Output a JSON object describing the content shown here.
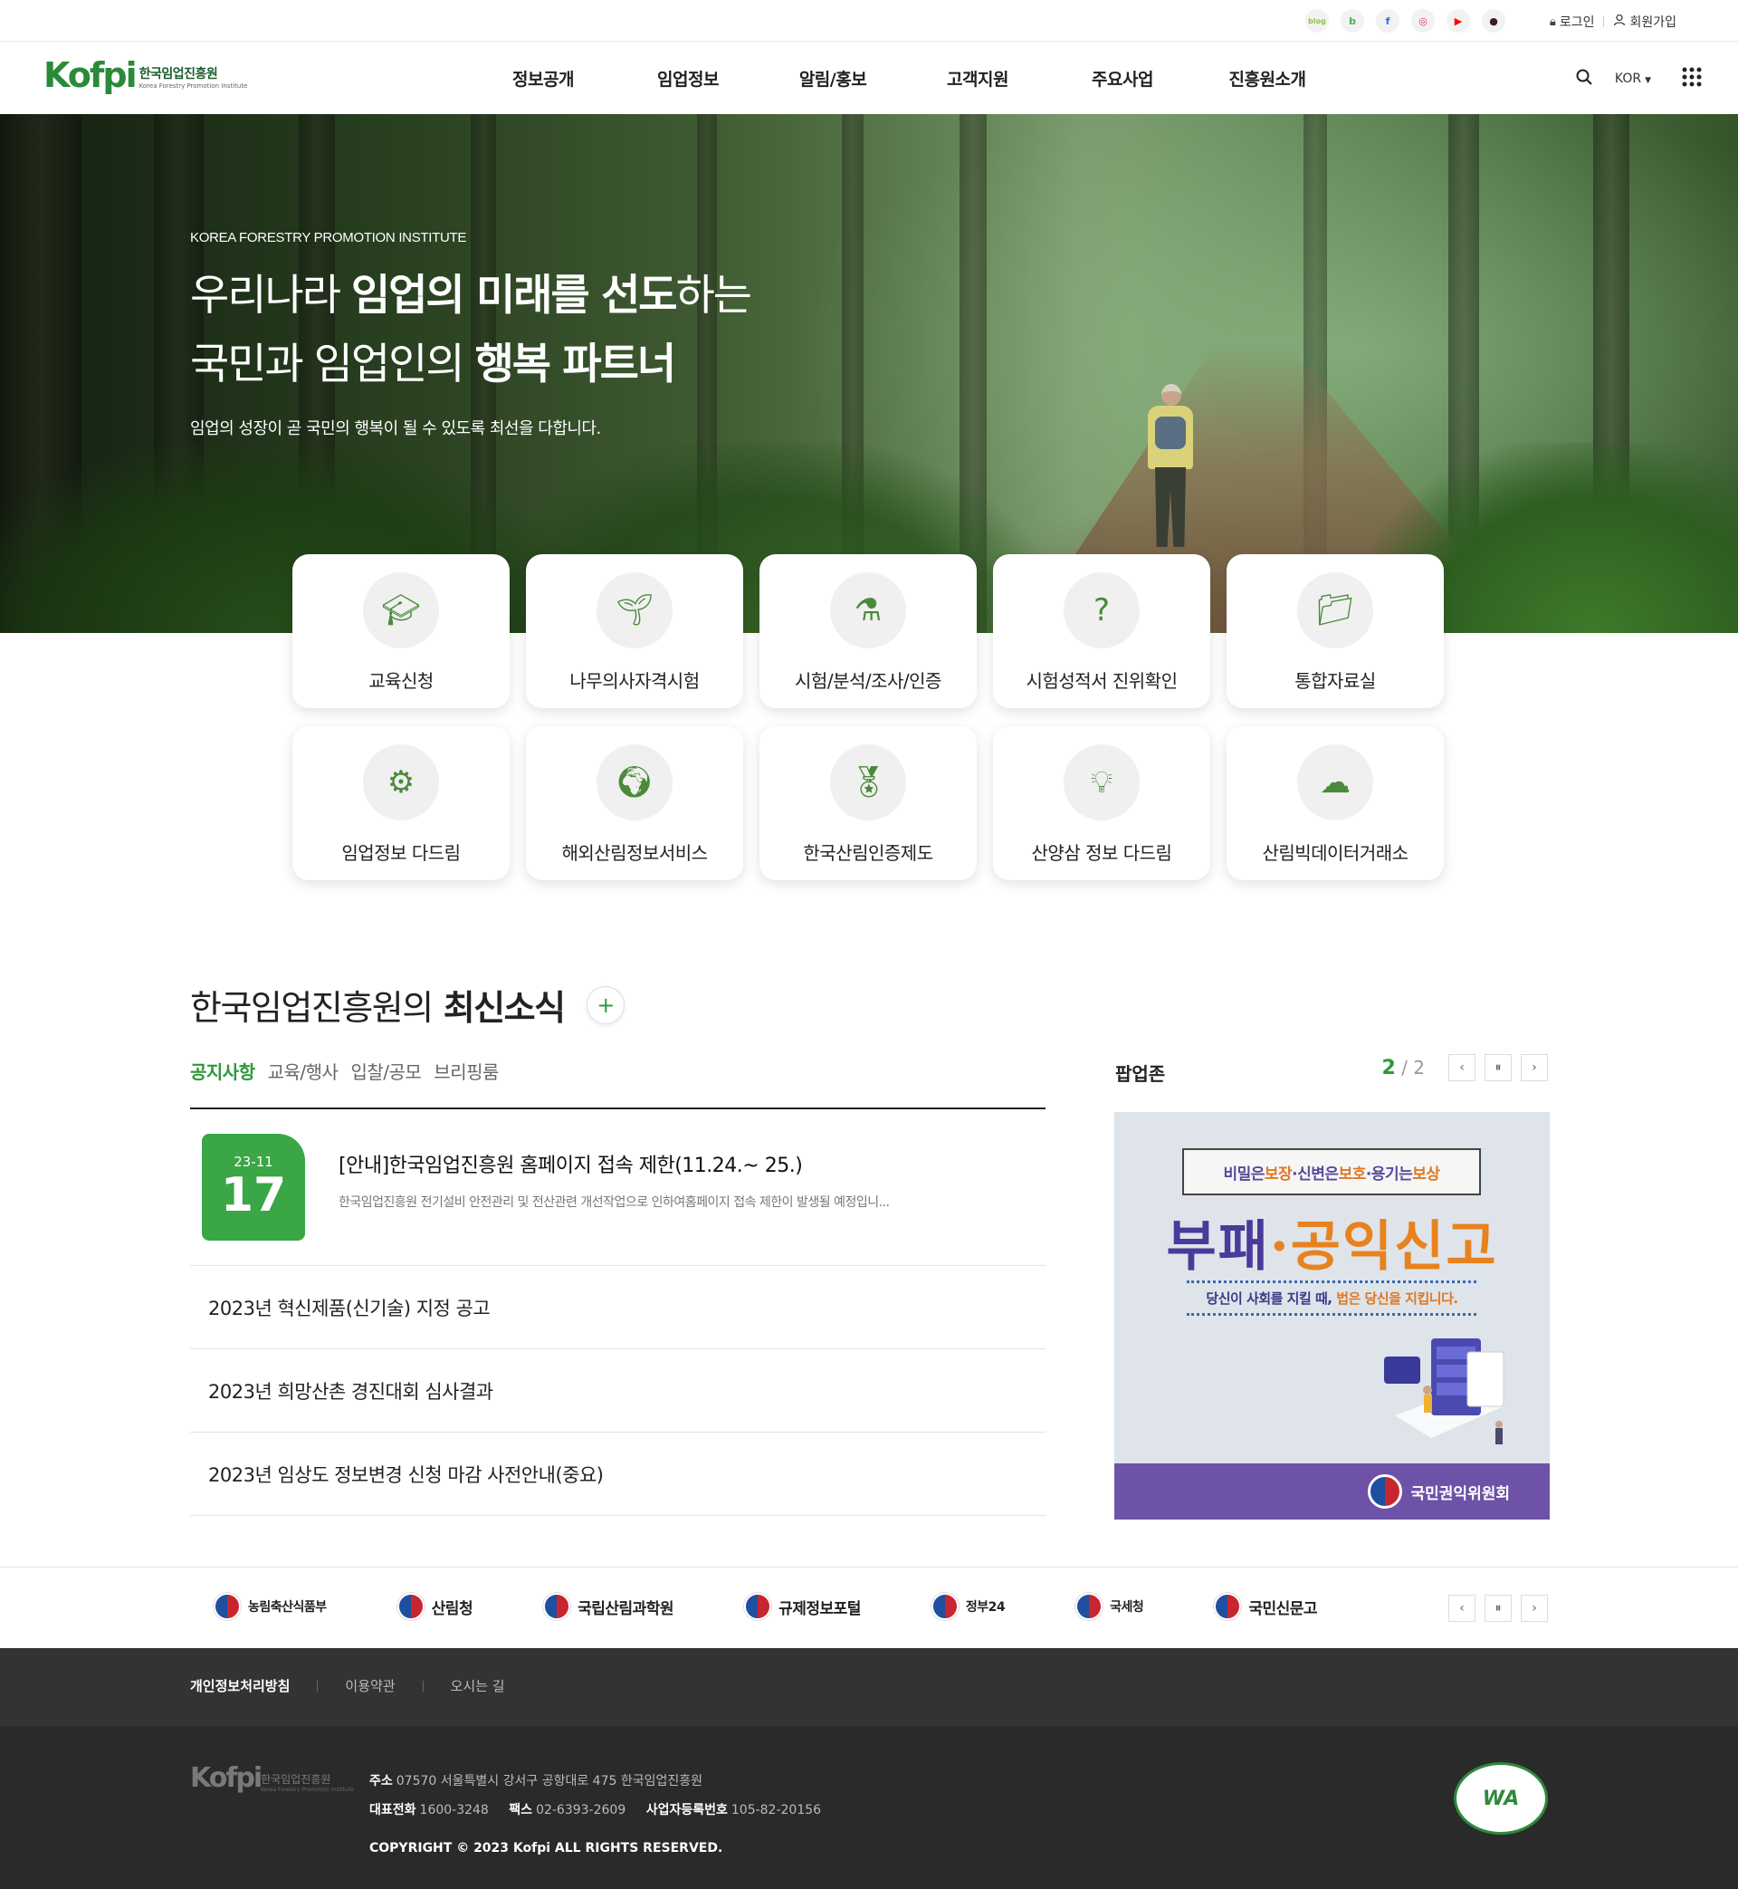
{
  "util": {
    "sns": [
      {
        "icon": "blog-icon",
        "text": "blog",
        "color": "#8bc34a"
      },
      {
        "icon": "band-icon",
        "text": "b",
        "color": "#4caf50"
      },
      {
        "icon": "facebook-icon",
        "text": "f",
        "color": "#1877f2"
      },
      {
        "icon": "instagram-icon",
        "text": "◎",
        "color": "#e1306c"
      },
      {
        "icon": "youtube-icon",
        "text": "▶",
        "color": "#ff0000"
      },
      {
        "icon": "kakao-icon",
        "text": "●",
        "color": "#3c1e1e"
      }
    ],
    "login": "로그인",
    "signup": "회원가입"
  },
  "header": {
    "logo_mark": "Kofpi",
    "logo_ko": "한국임업진흥원",
    "logo_en": "Korea Forestry Promotion Institute",
    "nav": [
      "정보공개",
      "임업정보",
      "알림/홍보",
      "고객지원",
      "주요사업",
      "진흥원소개"
    ],
    "lang": "KOR"
  },
  "hero": {
    "eyebrow": "KOREA FORESTRY PROMOTION INSTITUTE",
    "line1_a": "우리나라 ",
    "line1_b": "임업의 미래를 선도",
    "line1_c": "하는",
    "line2_a": "국민과 임업인의 ",
    "line2_b": "행복 파트너",
    "desc": "임업의 성장이 곧 국민의 행복이 될 수 있도록 최선을 다합니다."
  },
  "quick": [
    {
      "label": "교육신청",
      "icon": "graduation-cap-icon"
    },
    {
      "label": "나무의사자격시험",
      "icon": "sprout-bulb-icon"
    },
    {
      "label": "시험/분석/조사/인증",
      "icon": "lab-flask-icon"
    },
    {
      "label": "시험성적서 진위확인",
      "icon": "question-monitor-icon"
    },
    {
      "label": "통합자료실",
      "icon": "folder-icon"
    },
    {
      "label": "임업정보 다드림",
      "icon": "gear-tool-icon"
    },
    {
      "label": "해외산림정보서비스",
      "icon": "globe-hand-icon"
    },
    {
      "label": "한국산림인증제도",
      "icon": "medal-icon"
    },
    {
      "label": "산양삼 정보 다드림",
      "icon": "head-bulb-icon"
    },
    {
      "label": "산림빅데이터거래소",
      "icon": "cloud-data-icon"
    }
  ],
  "news": {
    "title_a": "한국임업진흥원의",
    "title_b": "최신소식",
    "tabs": [
      "공지사항",
      "교육/행사",
      "입찰/공모",
      "브리핑룸"
    ],
    "featured": {
      "ym": "23-11",
      "day": "17",
      "title": "[안내]한국임업진흥원 홈페이지 접속 제한(11.24.~ 25.)",
      "desc": "한국임업진흥원 전기설비 안전관리 및 전산관련 개선작업으로 인하여홈페이지 접속 제한이 발생될 예정입니..."
    },
    "items": [
      "2023년 혁신제품(신기술) 지정 공고",
      "2023년 희망산촌 경진대회 심사결과",
      "2023년 임상도 정보변경 신청 마감 사전안내(중요)"
    ]
  },
  "popup": {
    "title": "팝업존",
    "current": "2",
    "total": "/ 2",
    "banner": {
      "quote_a": "비밀은 ",
      "quote_b": "보장",
      "quote_c": "·신변은 ",
      "quote_d": "보호",
      "quote_e": "·용기는 ",
      "quote_f": "보상",
      "big_a": "부패",
      "big_b": "·",
      "big_c": "공익신고",
      "tag_a": "당신이 사회를 지킬 때, ",
      "tag_b": "법은 당신을 지킵니다.",
      "org": "국민권익위원회"
    }
  },
  "related": [
    {
      "name": "농림축산식품부",
      "size": "sm"
    },
    {
      "name": "산림청",
      "size": ""
    },
    {
      "name": "국립산림과학원",
      "size": ""
    },
    {
      "name": "규제정보포털",
      "size": ""
    },
    {
      "name": "정부24",
      "size": "sm"
    },
    {
      "name": "국세청",
      "size": "sm"
    },
    {
      "name": "국민신문고",
      "size": ""
    }
  ],
  "footer": {
    "links": [
      "개인정보처리방침",
      "이용약관",
      "오시는 길"
    ],
    "addr_label": "주소",
    "addr": "07570 서울특별시 강서구 공항대로 475 한국임업진흥원",
    "tel_label": "대표전화",
    "tel": "1600-3248",
    "fax_label": "팩스",
    "fax": "02-6393-2609",
    "biz_label": "사업자등록번호",
    "biz": "105-82-20156",
    "copyright": "COPYRIGHT © 2023 Kofpi ALL RIGHTS RESERVED.",
    "wa_mark": "WA"
  }
}
